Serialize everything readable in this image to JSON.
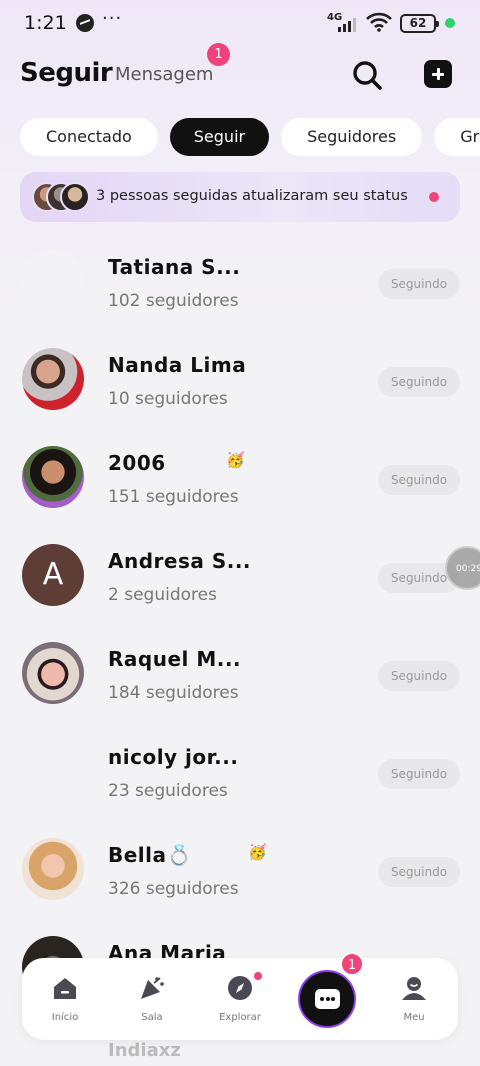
{
  "status_bar": {
    "time": "1:21",
    "dots": "···",
    "network": "4G",
    "battery": "62"
  },
  "header": {
    "title": "Seguir",
    "messages_tab": "Mensagem",
    "messages_badge": "1"
  },
  "chips": [
    {
      "label": "Conectado",
      "active": false
    },
    {
      "label": "Seguir",
      "active": true
    },
    {
      "label": "Seguidores",
      "active": false
    },
    {
      "label": "Gru",
      "active": false
    }
  ],
  "banner": {
    "text": "3 pessoas seguidas atualizaram seu status"
  },
  "follow_list": [
    {
      "name": "Tatiana S...",
      "followers": "102 seguidores",
      "button": "Seguindo",
      "avatar": "blank",
      "emoji": ""
    },
    {
      "name": "Nanda Lima",
      "followers": "10 seguidores",
      "button": "Seguindo",
      "avatar": "photo-red",
      "emoji": ""
    },
    {
      "name": "2006",
      "followers": "151 seguidores",
      "button": "Seguindo",
      "avatar": "photo-dark",
      "emoji": "🥳"
    },
    {
      "name": "Andresa S...",
      "followers": "2 seguidores",
      "button": "Seguindo",
      "avatar": "letter",
      "letter": "A",
      "emoji": ""
    },
    {
      "name": "Raquel M...",
      "followers": "184 seguidores",
      "button": "Seguindo",
      "avatar": "photo-pink",
      "emoji": ""
    },
    {
      "name": "nicoly jor...",
      "followers": "23 seguidores",
      "button": "Seguindo",
      "avatar": "blank",
      "emoji": ""
    },
    {
      "name": "Bella💍",
      "followers": "326 seguidores",
      "button": "Seguindo",
      "avatar": "photo-blonde",
      "emoji": "🥳"
    },
    {
      "name": "Ana Maria",
      "followers": "",
      "button": "",
      "avatar": "photo-dark",
      "emoji": ""
    }
  ],
  "peek_name": "Indiaxz",
  "recording_timer": "00:29",
  "bottom_nav": {
    "items": [
      {
        "label": "Início",
        "icon": "home-icon"
      },
      {
        "label": "Sala",
        "icon": "party-icon"
      },
      {
        "label": "Explorar",
        "icon": "compass-icon"
      },
      {
        "label": "",
        "icon": "chat-icon"
      },
      {
        "label": "Meu",
        "icon": "profile-icon"
      }
    ],
    "chat_badge": "1"
  },
  "colors": {
    "accent_pink": "#f0437a",
    "active_chip": "#111111",
    "banner_bg": "#e2d6f6",
    "ring": "#8c3ff2"
  }
}
